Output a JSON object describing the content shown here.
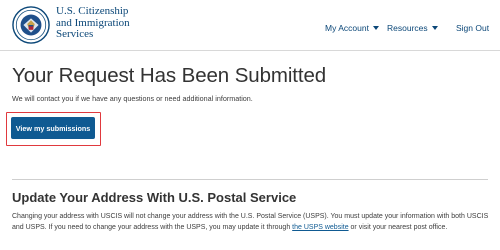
{
  "header": {
    "agency_line1": "U.S. Citizenship",
    "agency_line2": "and Immigration",
    "agency_line3": "Services",
    "nav": {
      "my_account": "My Account",
      "resources": "Resources",
      "sign_out": "Sign Out"
    }
  },
  "main": {
    "title": "Your Request Has Been Submitted",
    "subtitle": "We will contact you if we have any questions or need additional information.",
    "view_button": "View my submissions"
  },
  "address_section": {
    "heading": "Update Your Address With U.S. Postal Service",
    "text_part1": "Changing your address with USCIS will not change your address with the U.S. Postal Service (USPS). You must update your information with both USCIS and USPS. If you need to change your address with the USPS, you may update it through ",
    "link_text": "the USPS website",
    "text_part2": " or visit your nearest post office."
  },
  "colors": {
    "brand_blue": "#0b4778",
    "button_blue": "#0f5a92",
    "highlight_red": "#e0393e"
  },
  "icons": {
    "seal": "dhs-seal-icon",
    "dropdown": "caret-down-icon"
  }
}
